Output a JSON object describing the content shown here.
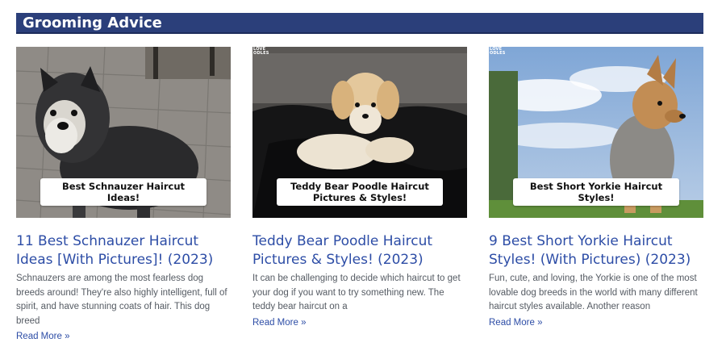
{
  "section": {
    "title": "Grooming Advice"
  },
  "posts": [
    {
      "image_label": "Best Schnauzer Haircut Ideas!",
      "brand_mark": "",
      "title": "11 Best Schnauzer Haircut Ideas [With Pictures]! (2023)",
      "excerpt": "Schnauzers are among the most fearless dog breeds around! They're also highly intelligent, full of spirit, and have stunning coats of hair. This dog breed",
      "read_more": "Read More »"
    },
    {
      "image_label": "Teddy Bear Poodle Haircut Pictures & Styles!",
      "brand_mark": "LOVE\nODLES",
      "title": "Teddy Bear Poodle Haircut Pictures & Styles! (2023)",
      "excerpt": "It can be challenging to decide which haircut to get your dog if you want to try something new. The teddy bear haircut on a",
      "read_more": "Read More »"
    },
    {
      "image_label": "Best Short Yorkie Haircut Styles!",
      "brand_mark": "LOVE\nODLES",
      "title": "9 Best Short Yorkie Haircut Styles! (With Pictures) (2023)",
      "excerpt": "Fun, cute, and loving, the Yorkie is one of the most lovable dog breeds in the world with many different haircut styles available. Another reason",
      "read_more": "Read More »"
    }
  ],
  "colors": {
    "header_bg": "#2b3f7a",
    "link": "#2d4da6",
    "text": "#555b63"
  }
}
